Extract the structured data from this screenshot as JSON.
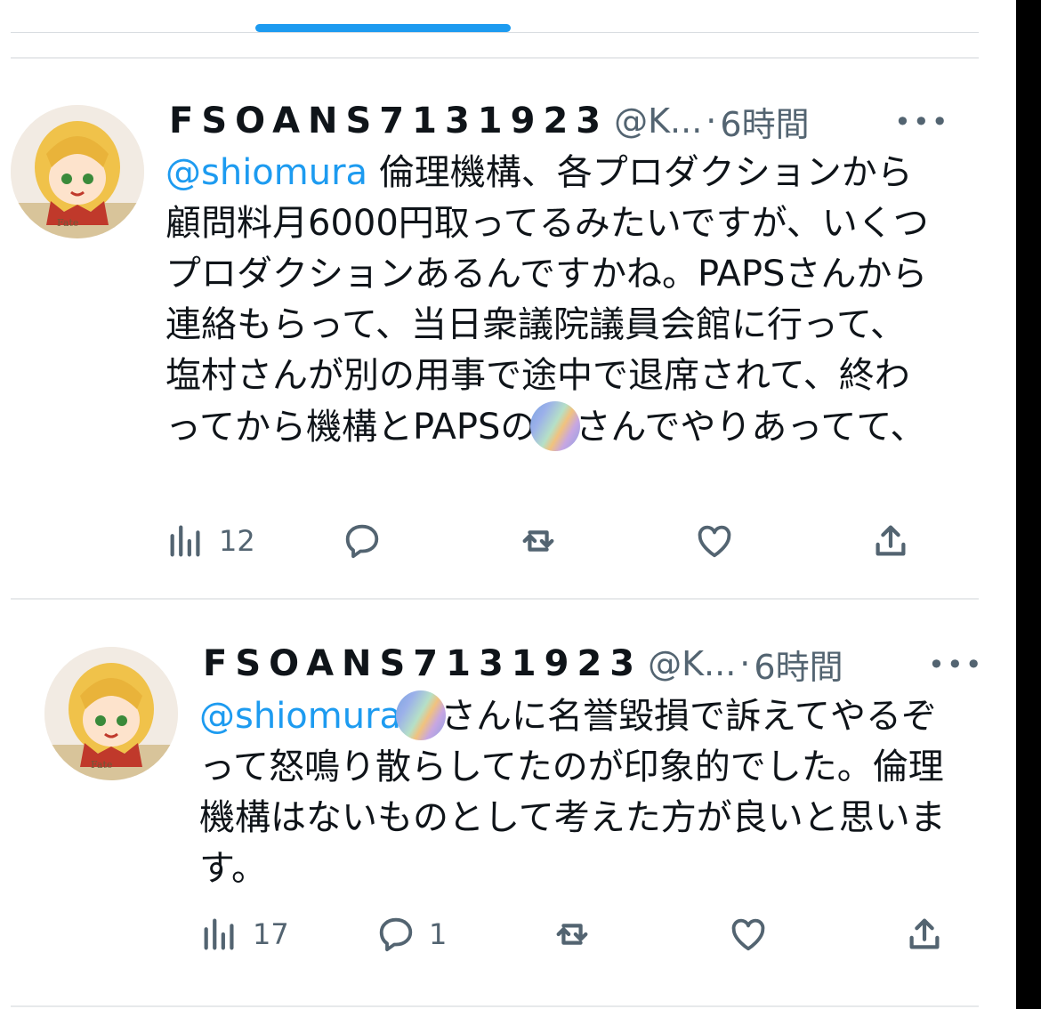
{
  "tweets": [
    {
      "display_name": "FSOANS7131923",
      "handle": "@K...",
      "separator": "·",
      "time": "6時間",
      "more_icon": "more-horizontal-icon",
      "mention": "@shiomura",
      "text_part1": " 倫理機構、各プロダクションから顧問料月6000円取ってるみたいですが、いくつプロダクションあるんですかね。PAPSさんから連絡もらって、当日衆議院議員会館に行って、塩村さんが別の用事で途中で退席されて、終わってから機構とPAPSの",
      "text_part2": "さんでやりあってて、",
      "views": "12",
      "replies": "",
      "retweets": "",
      "likes": ""
    },
    {
      "display_name": "FSOANS7131923",
      "handle": "@K...",
      "separator": "·",
      "time": "6時間",
      "more_icon": "more-horizontal-icon",
      "mention": "@shiomura",
      "text_part1": "",
      "text_part2": "さんに名誉毀損で訴えてやるぞって怒鳴り散らしてたのが印象的でした。倫理機構はないものとして考えた方が良いと思います。",
      "views": "17",
      "replies": "1",
      "retweets": "",
      "likes": ""
    }
  ],
  "colors": {
    "mention": "#1d9bf0",
    "muted": "#536471",
    "text": "#0f1419",
    "tab_indicator": "#1d9bf0"
  },
  "icons": [
    "views-icon",
    "reply-icon",
    "retweet-icon",
    "like-icon",
    "share-icon"
  ]
}
